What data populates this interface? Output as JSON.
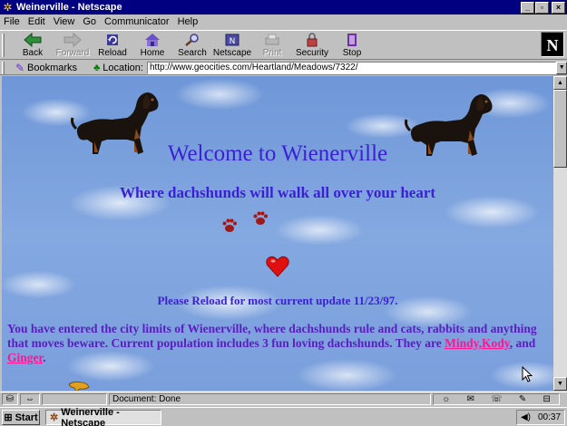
{
  "window": {
    "title": "Weinerville - Netscape",
    "controls": [
      "_",
      "▫",
      "×"
    ]
  },
  "menu": [
    "File",
    "Edit",
    "View",
    "Go",
    "Communicator",
    "Help"
  ],
  "toolbar": {
    "back": "Back",
    "forward": "Forward",
    "reload": "Reload",
    "home": "Home",
    "search": "Search",
    "netscape": "Netscape",
    "print": "Print",
    "security": "Security",
    "stop": "Stop"
  },
  "location_bar": {
    "bookmarks": "Bookmarks",
    "location_label": "Location:",
    "url": "http://www.geocities.com/Heartland/Meadows/7322/"
  },
  "page": {
    "heading": "Welcome to Wienerville",
    "subheading": "Where dachshunds will walk all over your heart",
    "update": "Please Reload for most current update 11/23/97.",
    "intro_text": "You have entered the city limits of Wienerville, where dachshunds rule and cats, rabbits and anything that moves beware. Current population includes 3 fun loving dachshunds. They are ",
    "link_mindy_kody": "Mindy,Kody",
    "and_text": ", and ",
    "link_ginger": "Ginger",
    "end_text": "."
  },
  "status": {
    "text": "Document: Done"
  },
  "taskbar": {
    "start": "Start",
    "task": "Weinerville - Netscape",
    "clock": "00:37"
  },
  "colors": {
    "title_bar": "#000080",
    "heading": "#3b1fd6",
    "intro_text": "#5b1dc0",
    "link": "#ff1493"
  }
}
